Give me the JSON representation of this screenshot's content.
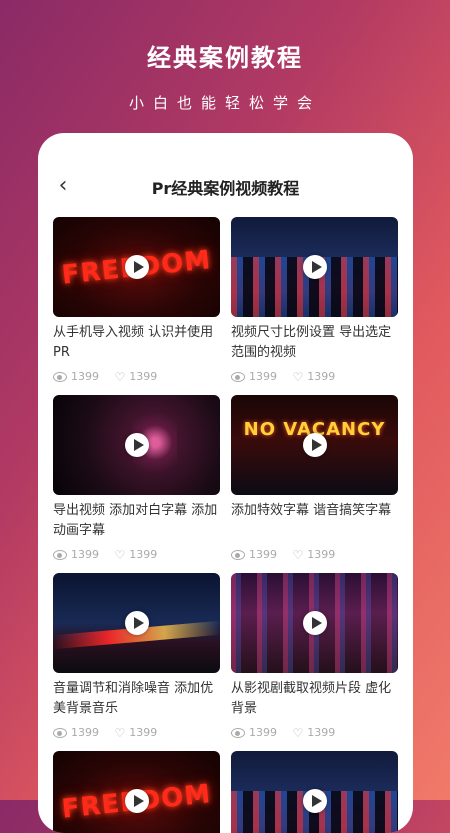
{
  "header": {
    "title": "经典案例教程",
    "subtitle": "小白也能轻松学会"
  },
  "card": {
    "back_icon": "chevron-left-icon",
    "title": "Pr经典案例视频教程"
  },
  "videos": [
    {
      "caption": "从手机导入视频 认识并使用PR",
      "views": "1399",
      "likes": "1399",
      "thumb_text": "FREEDOM",
      "theme": "freedom"
    },
    {
      "caption": "视频尺寸比例设置 导出选定范围的视频",
      "views": "1399",
      "likes": "1399",
      "thumb_text": "",
      "theme": "city"
    },
    {
      "caption": "导出视频 添加对白字幕 添加动画字幕",
      "views": "1399",
      "likes": "1399",
      "thumb_text": "",
      "theme": "jar"
    },
    {
      "caption": "添加特效字幕 谐音搞笑字幕",
      "views": "1399",
      "likes": "1399",
      "thumb_text": "NO VACANCY",
      "theme": "vacancy"
    },
    {
      "caption": "音量调节和消除噪音 添加优美背景音乐",
      "views": "1399",
      "likes": "1399",
      "thumb_text": "",
      "theme": "road"
    },
    {
      "caption": "从影视剧截取视频片段 虚化背景",
      "views": "1399",
      "likes": "1399",
      "thumb_text": "",
      "theme": "alley"
    },
    {
      "caption": "",
      "views": "",
      "likes": "",
      "thumb_text": "FREEDOM",
      "theme": "freedom"
    },
    {
      "caption": "",
      "views": "",
      "likes": "",
      "thumb_text": "",
      "theme": "city"
    }
  ],
  "colors": {
    "accent_gradient_start": "#8a2a66",
    "accent_gradient_end": "#f07a6a"
  }
}
